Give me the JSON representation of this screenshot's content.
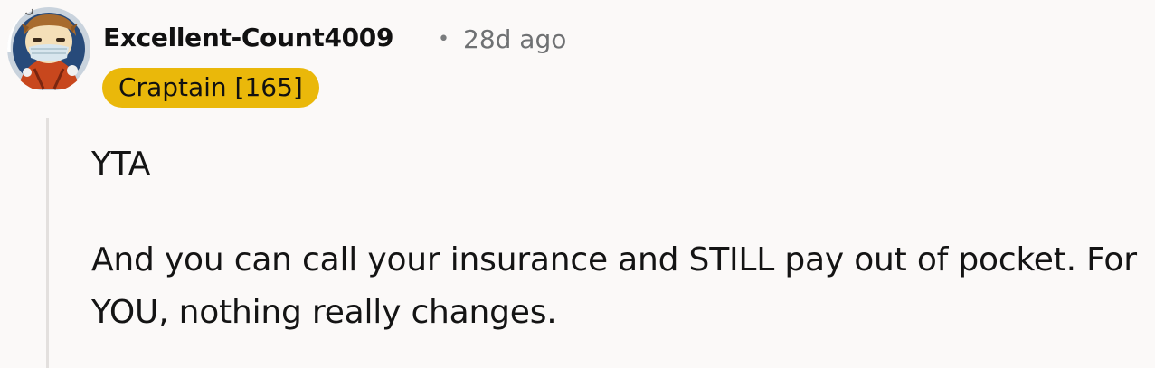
{
  "comment": {
    "author": "Excellent-Count4009",
    "separator": "•",
    "timestamp": "28d ago",
    "flair": "Craptain [165]",
    "avatar_icon": "user-avatar-snoo-icon",
    "paragraphs": [
      "YTA",
      "And you can call your insurance and STILL pay out of pocket. For YOU, nothing really changes."
    ]
  },
  "colors": {
    "background": "#fbf9f8",
    "flair_background": "#eab80a",
    "thread_line": "#e3e0de",
    "meta_text": "#6f7173"
  }
}
